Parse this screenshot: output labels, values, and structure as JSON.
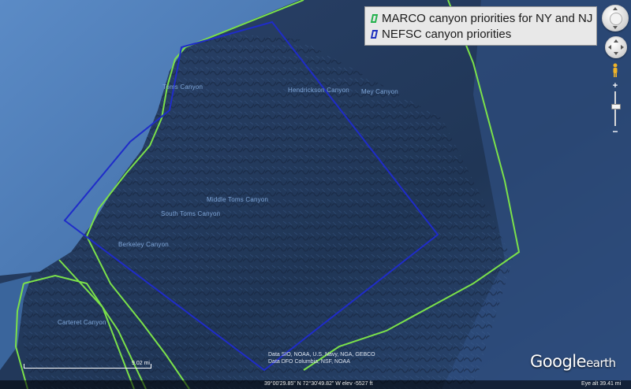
{
  "legend": {
    "items": [
      {
        "label": "MARCO canyon priorities for NY and NJ",
        "color": "#22b14c"
      },
      {
        "label": "NEFSC canyon priorities",
        "color": "#1c2fbf"
      }
    ]
  },
  "canyon_labels": [
    {
      "id": "toms",
      "text": "Toms Canyon"
    },
    {
      "id": "hendrickson",
      "text": "Hendrickson Canyon"
    },
    {
      "id": "mey",
      "text": "Mey Canyon"
    },
    {
      "id": "middle-toms",
      "text": "Middle Toms Canyon"
    },
    {
      "id": "south-toms",
      "text": "South Toms Canyon"
    },
    {
      "id": "berkeley",
      "text": "Berkeley Canyon"
    },
    {
      "id": "carteret",
      "text": "Carteret Canyon"
    }
  ],
  "colors": {
    "marco_line": "#7be14a",
    "nefsc_line": "#1f2cc9",
    "shelf": "#4f7db6",
    "deep": "#22385e"
  },
  "attribution": {
    "line1": "Data SIO, NOAA, U.S. Navy, NGA, GEBCO",
    "line2": "Data DFO Columbia, NSF, NOAA"
  },
  "scale_label": "9.02 mi",
  "status": {
    "coordinates": "39°00'29.85\" N   72°30'49.82\" W  elev -5527 ft",
    "eye_alt": "Eye alt   39.41 mi"
  },
  "logo": {
    "text": "Google",
    "suffix": "earth"
  },
  "icons": {
    "look": "look-joystick-icon",
    "move": "move-joystick-icon",
    "street": "pegman-icon",
    "zoom_in": "plus-icon",
    "zoom_out": "minus-icon"
  }
}
